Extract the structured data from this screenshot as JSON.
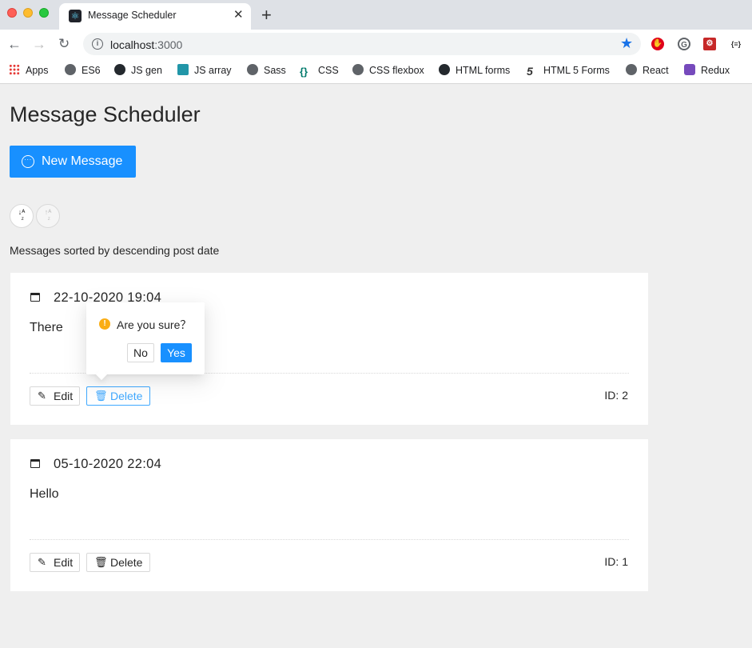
{
  "browser": {
    "tab_title": "Message Scheduler",
    "new_tab": "+",
    "url_host": "localhost",
    "url_port": ":3000",
    "bookmarks": [
      {
        "label": "Apps",
        "icon": "apps-grid-icon"
      },
      {
        "label": "ES6",
        "icon": "globe-icon"
      },
      {
        "label": "JS gen",
        "icon": "github-icon"
      },
      {
        "label": "JS array",
        "icon": "js-icon"
      },
      {
        "label": "Sass",
        "icon": "globe-icon"
      },
      {
        "label": "CSS",
        "icon": "braces-icon"
      },
      {
        "label": "CSS flexbox",
        "icon": "globe-icon"
      },
      {
        "label": "HTML forms",
        "icon": "github-icon"
      },
      {
        "label": "HTML 5 Forms",
        "icon": "html5-icon"
      },
      {
        "label": "React",
        "icon": "globe-icon"
      },
      {
        "label": "Redux",
        "icon": "redux-icon"
      }
    ]
  },
  "page": {
    "title": "Message Scheduler",
    "new_message_label": "New Message",
    "sort_caption": "Messages sorted by descending post date"
  },
  "messages": [
    {
      "date": "22-10-2020 19:04",
      "text": "There",
      "id_label": "ID: 2",
      "edit_label": "Edit",
      "delete_label": "Delete"
    },
    {
      "date": "05-10-2020 22:04",
      "text": "Hello",
      "id_label": "ID: 1",
      "edit_label": "Edit",
      "delete_label": "Delete"
    }
  ],
  "popconfirm": {
    "message": "Are you sure？",
    "cancel_label": "No",
    "ok_label": "Yes"
  },
  "colors": {
    "primary": "#1890ff",
    "warning": "#faad14",
    "page_bg": "#efefef"
  }
}
